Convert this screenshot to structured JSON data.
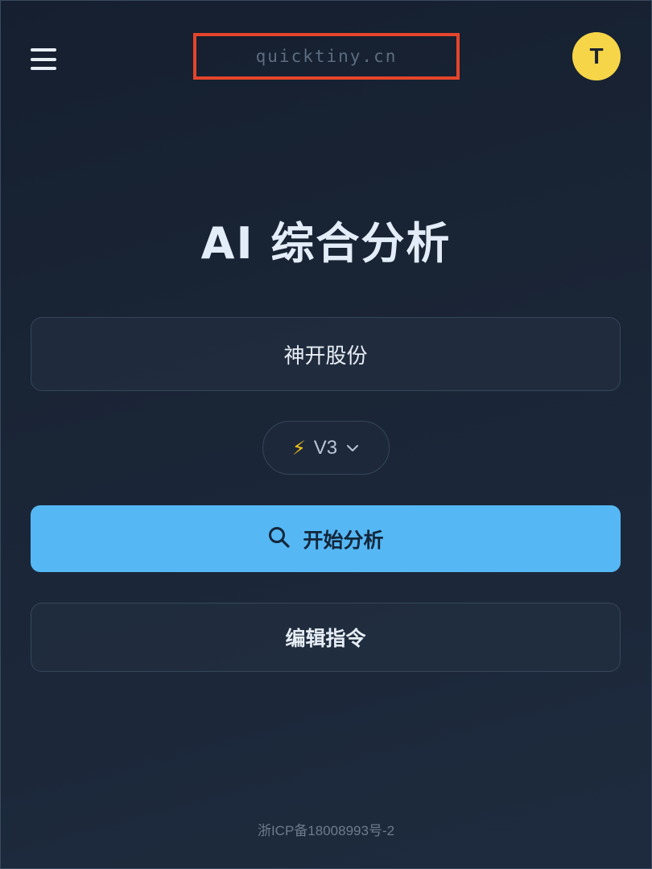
{
  "header": {
    "menu_icon": "hamburger-menu-icon",
    "logo_text": "quicktiny.cn",
    "avatar_letter": "T",
    "avatar_color": "#f7d548",
    "highlight_color": "#e5452b"
  },
  "main": {
    "title": "AI 综合分析",
    "stock_input_value": "神开股份",
    "version_select": {
      "icon": "lightning-bolt-icon",
      "selected": "V3"
    },
    "start_button": {
      "icon": "search-icon",
      "label": "开始分析",
      "color": "#55b8f5"
    },
    "edit_button": {
      "label": "编辑指令"
    }
  },
  "footer": {
    "icp": "浙ICP备18008993号-2"
  }
}
